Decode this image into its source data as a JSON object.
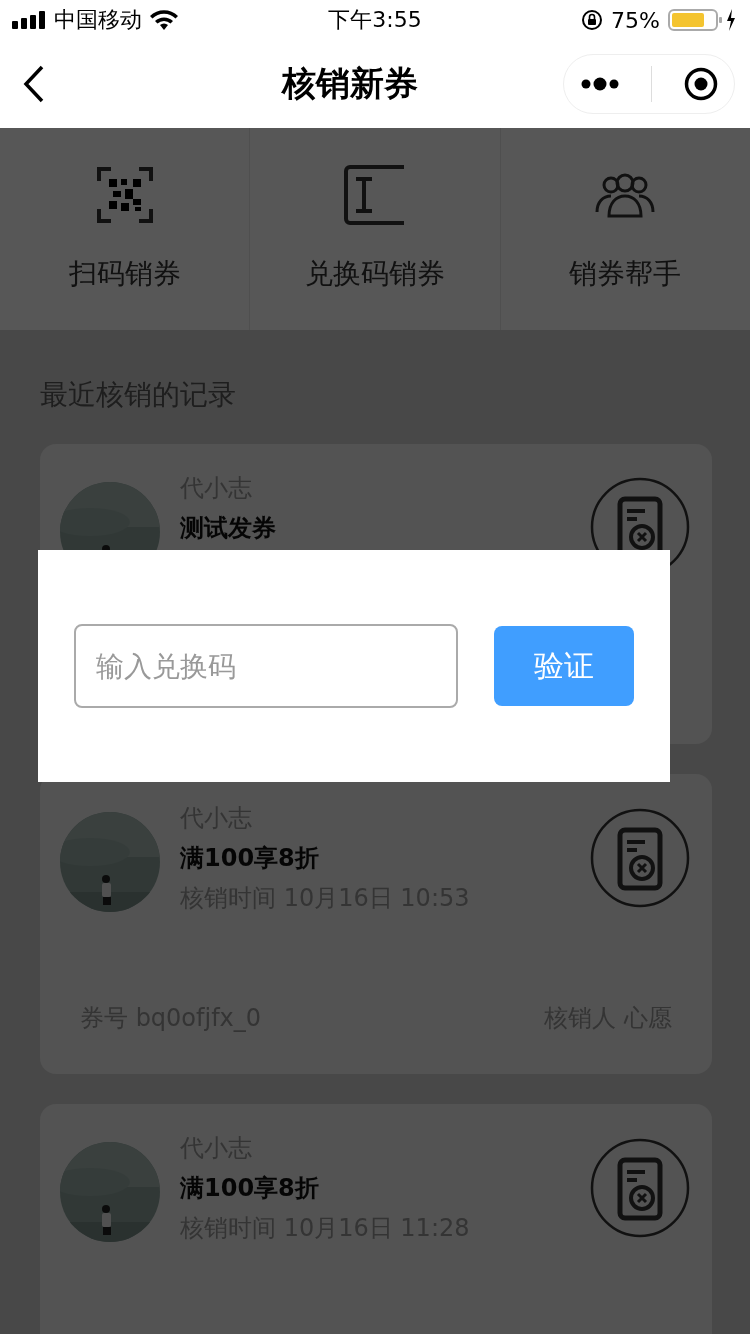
{
  "status_bar": {
    "carrier": "中国移动",
    "time": "下午3:55",
    "battery_percent": "75%"
  },
  "nav": {
    "title": "核销新券"
  },
  "actions": [
    {
      "label": "扫码销券",
      "kind": "scan"
    },
    {
      "label": "兑换码销券",
      "kind": "code"
    },
    {
      "label": "销券帮手",
      "kind": "helper"
    }
  ],
  "section_title": "最近核销的记录",
  "records": [
    {
      "name": "代小志",
      "coupon": "测试发券"
    },
    {
      "name": "代小志",
      "coupon": "满100享8折",
      "time": "核销时间 10月16日 10:53",
      "coupon_no": "券号 bq0ofjfx_0",
      "operator": "核销人 心愿"
    },
    {
      "name": "代小志",
      "coupon": "满100享8折",
      "time": "核销时间 10月16日 11:28"
    }
  ],
  "dialog": {
    "placeholder": "输入兑换码",
    "button": "验证"
  }
}
